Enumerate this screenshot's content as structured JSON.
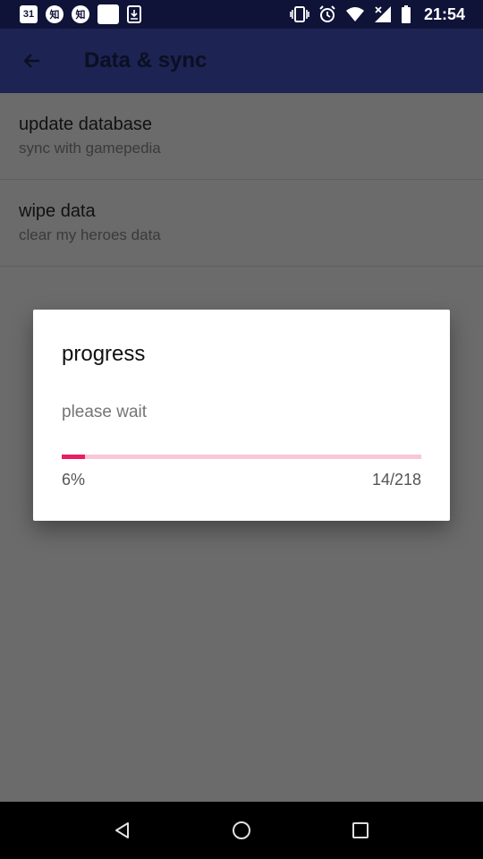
{
  "status_bar": {
    "time": "21:54",
    "notif_calendar": "31",
    "notif_zhihu_1": "知",
    "notif_zhihu_2": "知"
  },
  "app_bar": {
    "title": "Data & sync"
  },
  "preferences": [
    {
      "title": "update database",
      "summary": "sync with gamepedia"
    },
    {
      "title": "wipe data",
      "summary": "clear my heroes data"
    }
  ],
  "dialog": {
    "title": "progress",
    "message": "please wait",
    "percent_label": "6%",
    "count_label": "14/218",
    "progress_fraction": 0.064
  },
  "colors": {
    "accent": "#e91e63",
    "accent_track": "#f9c7d8",
    "app_bar": "#1d2352",
    "status_bar": "#0f1338"
  }
}
